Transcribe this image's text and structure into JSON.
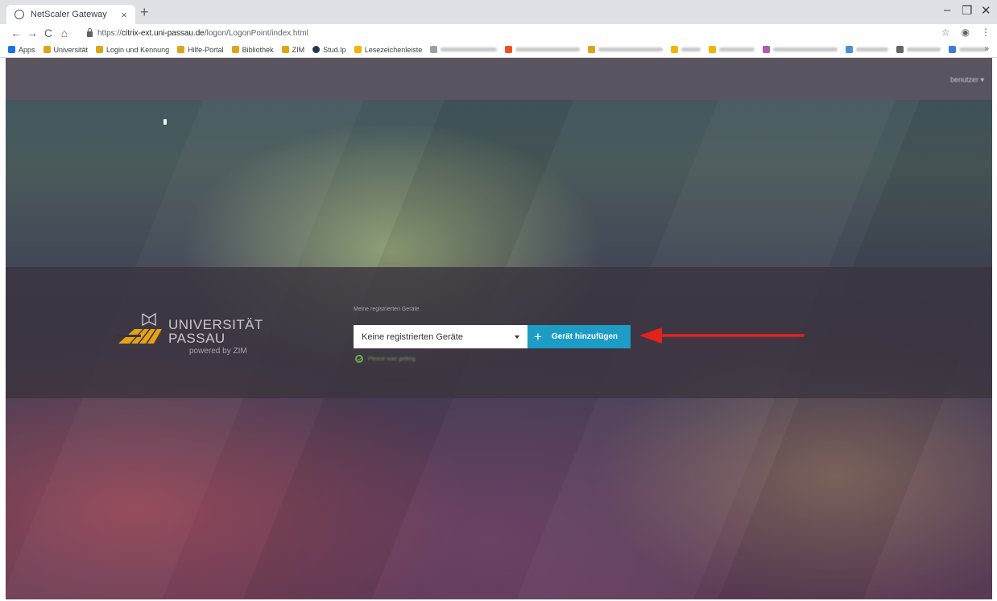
{
  "browser": {
    "tab_title": "NetScaler Gateway",
    "tab_close": "×",
    "new_tab": "+",
    "window_controls": [
      "–",
      "❐",
      "✕"
    ],
    "url_scheme": "https://",
    "url_host": "citrix-ext.uni-passau.de",
    "url_path": "/logon/LogonPoint/index.html",
    "nav": [
      "←",
      "→",
      "C",
      "⌂"
    ],
    "toolbar_right": [
      "☆",
      "◉",
      "⋮"
    ],
    "bookmarks": [
      {
        "label": "Apps",
        "icon": "apps-grid-icon",
        "color": "#1a73e8"
      },
      {
        "label": "Universität",
        "icon": "uni-passau-icon",
        "color": "#e0a41a"
      },
      {
        "label": "Login und Kennung",
        "icon": "uni-passau-icon",
        "color": "#e0a41a"
      },
      {
        "label": "Hilfe-Portal",
        "icon": "uni-passau-icon",
        "color": "#e0a41a"
      },
      {
        "label": "Bibliothek",
        "icon": "uni-passau-icon",
        "color": "#e0a41a"
      },
      {
        "label": "ZIM",
        "icon": "uni-passau-icon",
        "color": "#e0a41a"
      },
      {
        "label": "Stud.Ip",
        "icon": "studip-icon",
        "color": "#24374f"
      },
      {
        "label": "Lesezeichenleiste",
        "icon": "folder-icon",
        "color": "#f4b400"
      }
    ],
    "bookmarks_more": "»"
  },
  "page": {
    "user_menu": "benutzer ▾",
    "logo": {
      "line1": "UNIVERSITÄT",
      "line2": "PASSAU",
      "powered": "powered by ZIM"
    },
    "form": {
      "caption": "Meine registrierten Geräte",
      "select_value": "Keine registrierten Geräte",
      "add_button_label": "Gerät hinzufügen",
      "add_button_icon": "+",
      "status_text": "Please wait getting"
    },
    "colors": {
      "accent": "#1d9cc6",
      "arrow": "#e3221c",
      "status_green": "#6aa84f"
    }
  }
}
